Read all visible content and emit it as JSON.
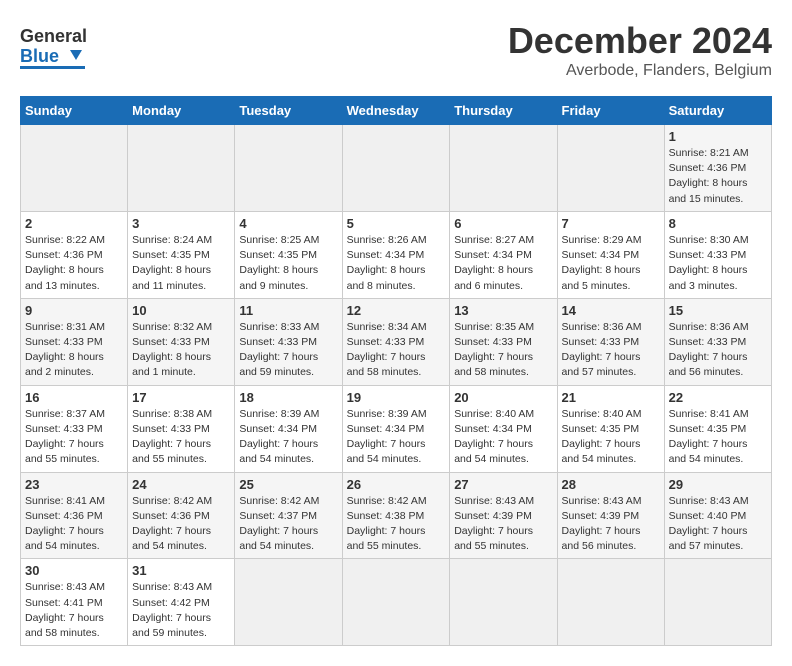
{
  "header": {
    "logo_line1": "General",
    "logo_line2": "Blue",
    "title": "December 2024",
    "subtitle": "Averbode, Flanders, Belgium"
  },
  "calendar": {
    "days_of_week": [
      "Sunday",
      "Monday",
      "Tuesday",
      "Wednesday",
      "Thursday",
      "Friday",
      "Saturday"
    ],
    "weeks": [
      [
        {
          "day": "",
          "empty": true
        },
        {
          "day": "",
          "empty": true
        },
        {
          "day": "",
          "empty": true
        },
        {
          "day": "",
          "empty": true
        },
        {
          "day": "",
          "empty": true
        },
        {
          "day": "",
          "empty": true
        },
        {
          "day": "1",
          "sunrise": "Sunrise: 8:21 AM",
          "sunset": "Sunset: 4:36 PM",
          "daylight": "Daylight: 8 hours and 15 minutes."
        }
      ],
      [
        {
          "day": "2",
          "sunrise": "Sunrise: 8:22 AM",
          "sunset": "Sunset: 4:36 PM",
          "daylight": "Daylight: 8 hours and 13 minutes."
        },
        {
          "day": "3",
          "sunrise": "Sunrise: 8:24 AM",
          "sunset": "Sunset: 4:35 PM",
          "daylight": "Daylight: 8 hours and 11 minutes."
        },
        {
          "day": "4",
          "sunrise": "Sunrise: 8:25 AM",
          "sunset": "Sunset: 4:35 PM",
          "daylight": "Daylight: 8 hours and 9 minutes."
        },
        {
          "day": "5",
          "sunrise": "Sunrise: 8:26 AM",
          "sunset": "Sunset: 4:34 PM",
          "daylight": "Daylight: 8 hours and 8 minutes."
        },
        {
          "day": "6",
          "sunrise": "Sunrise: 8:27 AM",
          "sunset": "Sunset: 4:34 PM",
          "daylight": "Daylight: 8 hours and 6 minutes."
        },
        {
          "day": "7",
          "sunrise": "Sunrise: 8:29 AM",
          "sunset": "Sunset: 4:34 PM",
          "daylight": "Daylight: 8 hours and 5 minutes."
        },
        {
          "day": "8",
          "sunrise": "Sunrise: 8:30 AM",
          "sunset": "Sunset: 4:33 PM",
          "daylight": "Daylight: 8 hours and 3 minutes."
        }
      ],
      [
        {
          "day": "9",
          "sunrise": "Sunrise: 8:31 AM",
          "sunset": "Sunset: 4:33 PM",
          "daylight": "Daylight: 8 hours and 2 minutes."
        },
        {
          "day": "10",
          "sunrise": "Sunrise: 8:32 AM",
          "sunset": "Sunset: 4:33 PM",
          "daylight": "Daylight: 8 hours and 1 minute."
        },
        {
          "day": "11",
          "sunrise": "Sunrise: 8:33 AM",
          "sunset": "Sunset: 4:33 PM",
          "daylight": "Daylight: 7 hours and 59 minutes."
        },
        {
          "day": "12",
          "sunrise": "Sunrise: 8:34 AM",
          "sunset": "Sunset: 4:33 PM",
          "daylight": "Daylight: 7 hours and 58 minutes."
        },
        {
          "day": "13",
          "sunrise": "Sunrise: 8:35 AM",
          "sunset": "Sunset: 4:33 PM",
          "daylight": "Daylight: 7 hours and 58 minutes."
        },
        {
          "day": "14",
          "sunrise": "Sunrise: 8:36 AM",
          "sunset": "Sunset: 4:33 PM",
          "daylight": "Daylight: 7 hours and 57 minutes."
        },
        {
          "day": "15",
          "sunrise": "Sunrise: 8:36 AM",
          "sunset": "Sunset: 4:33 PM",
          "daylight": "Daylight: 7 hours and 56 minutes."
        }
      ],
      [
        {
          "day": "16",
          "sunrise": "Sunrise: 8:37 AM",
          "sunset": "Sunset: 4:33 PM",
          "daylight": "Daylight: 7 hours and 55 minutes."
        },
        {
          "day": "17",
          "sunrise": "Sunrise: 8:38 AM",
          "sunset": "Sunset: 4:33 PM",
          "daylight": "Daylight: 7 hours and 55 minutes."
        },
        {
          "day": "18",
          "sunrise": "Sunrise: 8:39 AM",
          "sunset": "Sunset: 4:34 PM",
          "daylight": "Daylight: 7 hours and 54 minutes."
        },
        {
          "day": "19",
          "sunrise": "Sunrise: 8:39 AM",
          "sunset": "Sunset: 4:34 PM",
          "daylight": "Daylight: 7 hours and 54 minutes."
        },
        {
          "day": "20",
          "sunrise": "Sunrise: 8:40 AM",
          "sunset": "Sunset: 4:34 PM",
          "daylight": "Daylight: 7 hours and 54 minutes."
        },
        {
          "day": "21",
          "sunrise": "Sunrise: 8:40 AM",
          "sunset": "Sunset: 4:35 PM",
          "daylight": "Daylight: 7 hours and 54 minutes."
        },
        {
          "day": "22",
          "sunrise": "Sunrise: 8:41 AM",
          "sunset": "Sunset: 4:35 PM",
          "daylight": "Daylight: 7 hours and 54 minutes."
        }
      ],
      [
        {
          "day": "23",
          "sunrise": "Sunrise: 8:41 AM",
          "sunset": "Sunset: 4:36 PM",
          "daylight": "Daylight: 7 hours and 54 minutes."
        },
        {
          "day": "24",
          "sunrise": "Sunrise: 8:42 AM",
          "sunset": "Sunset: 4:36 PM",
          "daylight": "Daylight: 7 hours and 54 minutes."
        },
        {
          "day": "25",
          "sunrise": "Sunrise: 8:42 AM",
          "sunset": "Sunset: 4:37 PM",
          "daylight": "Daylight: 7 hours and 54 minutes."
        },
        {
          "day": "26",
          "sunrise": "Sunrise: 8:42 AM",
          "sunset": "Sunset: 4:38 PM",
          "daylight": "Daylight: 7 hours and 55 minutes."
        },
        {
          "day": "27",
          "sunrise": "Sunrise: 8:43 AM",
          "sunset": "Sunset: 4:39 PM",
          "daylight": "Daylight: 7 hours and 55 minutes."
        },
        {
          "day": "28",
          "sunrise": "Sunrise: 8:43 AM",
          "sunset": "Sunset: 4:39 PM",
          "daylight": "Daylight: 7 hours and 56 minutes."
        },
        {
          "day": "29",
          "sunrise": "Sunrise: 8:43 AM",
          "sunset": "Sunset: 4:40 PM",
          "daylight": "Daylight: 7 hours and 57 minutes."
        }
      ],
      [
        {
          "day": "30",
          "sunrise": "Sunrise: 8:43 AM",
          "sunset": "Sunset: 4:41 PM",
          "daylight": "Daylight: 7 hours and 58 minutes."
        },
        {
          "day": "31",
          "sunrise": "Sunrise: 8:43 AM",
          "sunset": "Sunset: 4:42 PM",
          "daylight": "Daylight: 7 hours and 59 minutes."
        },
        {
          "day": "",
          "empty": true
        },
        {
          "day": "",
          "empty": true
        },
        {
          "day": "",
          "empty": true
        },
        {
          "day": "",
          "empty": true
        },
        {
          "day": "",
          "empty": true
        }
      ]
    ]
  }
}
